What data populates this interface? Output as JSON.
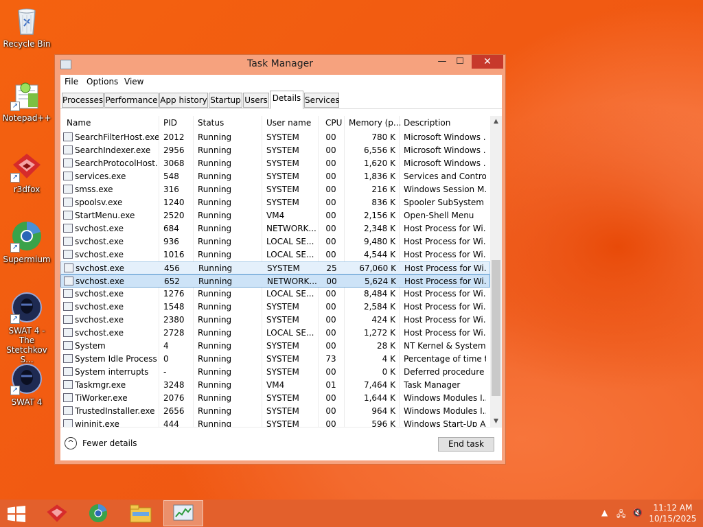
{
  "desktop": {
    "icons": [
      {
        "label": "Recycle Bin",
        "icon": "recycle-bin-icon"
      },
      {
        "label": "Notepad++",
        "icon": "notepad-plus-plus-icon"
      },
      {
        "label": "r3dfox",
        "icon": "r3dfox-icon"
      },
      {
        "label": "Supermium",
        "icon": "supermium-icon"
      },
      {
        "label": "SWAT 4 - The Stetchkov S...",
        "icon": "swat4-stetchkov-icon"
      },
      {
        "label": "SWAT 4",
        "icon": "swat4-icon"
      }
    ]
  },
  "window": {
    "title": "Task Manager",
    "controls": {
      "minimize": "—",
      "maximize": "☐",
      "close": "✕"
    },
    "menu": [
      "File",
      "Options",
      "View"
    ],
    "tabs": [
      "Processes",
      "Performance",
      "App history",
      "Startup",
      "Users",
      "Details",
      "Services"
    ],
    "active_tab": "Details",
    "columns": [
      "Name",
      "PID",
      "Status",
      "User name",
      "CPU",
      "Memory (p...",
      "Description"
    ],
    "rows": [
      {
        "name": "SearchFilterHost.exe",
        "pid": "2012",
        "status": "Running",
        "user": "SYSTEM",
        "cpu": "00",
        "mem": "780 K",
        "desc": "Microsoft Windows ...",
        "icon": "search-user-icon"
      },
      {
        "name": "SearchIndexer.exe",
        "pid": "2956",
        "status": "Running",
        "user": "SYSTEM",
        "cpu": "00",
        "mem": "6,556 K",
        "desc": "Microsoft Windows ...",
        "icon": "search-user-icon"
      },
      {
        "name": "SearchProtocolHost....",
        "pid": "3068",
        "status": "Running",
        "user": "SYSTEM",
        "cpu": "00",
        "mem": "1,620 K",
        "desc": "Microsoft Windows ...",
        "icon": "search-user-icon"
      },
      {
        "name": "services.exe",
        "pid": "548",
        "status": "Running",
        "user": "SYSTEM",
        "cpu": "00",
        "mem": "1,836 K",
        "desc": "Services and Control...",
        "icon": "process-window-icon"
      },
      {
        "name": "smss.exe",
        "pid": "316",
        "status": "Running",
        "user": "SYSTEM",
        "cpu": "00",
        "mem": "216 K",
        "desc": "Windows Session M...",
        "icon": "process-window-icon"
      },
      {
        "name": "spoolsv.exe",
        "pid": "1240",
        "status": "Running",
        "user": "SYSTEM",
        "cpu": "00",
        "mem": "836 K",
        "desc": "Spooler SubSystem ...",
        "icon": "printer-icon"
      },
      {
        "name": "StartMenu.exe",
        "pid": "2520",
        "status": "Running",
        "user": "VM4",
        "cpu": "00",
        "mem": "2,156 K",
        "desc": "Open-Shell Menu",
        "icon": "open-shell-icon"
      },
      {
        "name": "svchost.exe",
        "pid": "684",
        "status": "Running",
        "user": "NETWORK...",
        "cpu": "00",
        "mem": "2,348 K",
        "desc": "Host Process for Wi...",
        "icon": "process-window-icon"
      },
      {
        "name": "svchost.exe",
        "pid": "936",
        "status": "Running",
        "user": "LOCAL SE...",
        "cpu": "00",
        "mem": "9,480 K",
        "desc": "Host Process for Wi...",
        "icon": "process-window-icon"
      },
      {
        "name": "svchost.exe",
        "pid": "1016",
        "status": "Running",
        "user": "LOCAL SE...",
        "cpu": "00",
        "mem": "4,544 K",
        "desc": "Host Process for Wi...",
        "icon": "process-window-icon"
      },
      {
        "name": "svchost.exe",
        "pid": "456",
        "status": "Running",
        "user": "SYSTEM",
        "cpu": "25",
        "mem": "67,060 K",
        "desc": "Host Process for Wi...",
        "icon": "process-window-icon"
      },
      {
        "name": "svchost.exe",
        "pid": "652",
        "status": "Running",
        "user": "NETWORK...",
        "cpu": "00",
        "mem": "5,624 K",
        "desc": "Host Process for Wi...",
        "icon": "process-window-icon"
      },
      {
        "name": "svchost.exe",
        "pid": "1276",
        "status": "Running",
        "user": "LOCAL SE...",
        "cpu": "00",
        "mem": "8,484 K",
        "desc": "Host Process for Wi...",
        "icon": "process-window-icon"
      },
      {
        "name": "svchost.exe",
        "pid": "1548",
        "status": "Running",
        "user": "SYSTEM",
        "cpu": "00",
        "mem": "2,584 K",
        "desc": "Host Process for Wi...",
        "icon": "process-window-icon"
      },
      {
        "name": "svchost.exe",
        "pid": "2380",
        "status": "Running",
        "user": "SYSTEM",
        "cpu": "00",
        "mem": "424 K",
        "desc": "Host Process for Wi...",
        "icon": "process-window-icon"
      },
      {
        "name": "svchost.exe",
        "pid": "2728",
        "status": "Running",
        "user": "LOCAL SE...",
        "cpu": "00",
        "mem": "1,272 K",
        "desc": "Host Process for Wi...",
        "icon": "process-window-icon"
      },
      {
        "name": "System",
        "pid": "4",
        "status": "Running",
        "user": "SYSTEM",
        "cpu": "00",
        "mem": "28 K",
        "desc": "NT Kernel & System",
        "icon": "process-window-icon"
      },
      {
        "name": "System Idle Process",
        "pid": "0",
        "status": "Running",
        "user": "SYSTEM",
        "cpu": "73",
        "mem": "4 K",
        "desc": "Percentage of time t...",
        "icon": "process-window-icon"
      },
      {
        "name": "System interrupts",
        "pid": "-",
        "status": "Running",
        "user": "SYSTEM",
        "cpu": "00",
        "mem": "0 K",
        "desc": "Deferred procedure ...",
        "icon": "process-window-icon"
      },
      {
        "name": "Taskmgr.exe",
        "pid": "3248",
        "status": "Running",
        "user": "VM4",
        "cpu": "01",
        "mem": "7,464 K",
        "desc": "Task Manager",
        "icon": "task-manager-icon"
      },
      {
        "name": "TiWorker.exe",
        "pid": "2076",
        "status": "Running",
        "user": "SYSTEM",
        "cpu": "00",
        "mem": "1,644 K",
        "desc": "Windows Modules I...",
        "icon": "process-window-icon"
      },
      {
        "name": "TrustedInstaller.exe",
        "pid": "2656",
        "status": "Running",
        "user": "SYSTEM",
        "cpu": "00",
        "mem": "964 K",
        "desc": "Windows Modules I...",
        "icon": "process-window-icon"
      },
      {
        "name": "wininit.exe",
        "pid": "444",
        "status": "Running",
        "user": "SYSTEM",
        "cpu": "00",
        "mem": "596 K",
        "desc": "Windows Start-Up A...",
        "icon": "process-window-icon"
      }
    ],
    "fewer_details": "Fewer details",
    "end_task": "End task"
  },
  "taskbar": {
    "apps": [
      {
        "name": "r3dfox",
        "icon": "r3dfox-icon"
      },
      {
        "name": "Supermium",
        "icon": "supermium-icon"
      },
      {
        "name": "File Explorer",
        "icon": "file-explorer-icon"
      },
      {
        "name": "Task Manager",
        "icon": "task-manager-icon"
      }
    ],
    "clock": {
      "time": "11:12 AM",
      "date": "10/15/2025"
    }
  }
}
